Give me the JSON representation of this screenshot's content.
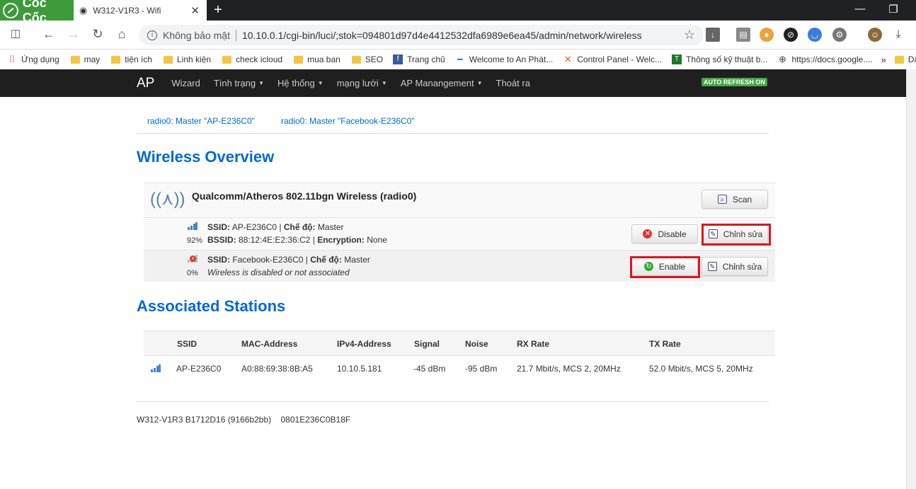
{
  "browser": {
    "brand": "Cốc Cốc",
    "tab_title": "W312-V1R3 - Wifi",
    "security": "Không bảo mật",
    "url": "10.10.0.1/cgi-bin/luci/;stok=094801d97d4e4412532dfa6989e6ea45/admin/network/wireless",
    "bookmarks": [
      "Ứng dụng",
      "may",
      "tiện ích",
      "Linh kiện",
      "check icloud",
      "mua ban",
      "SEO",
      "Trang chủ",
      "Welcome to An Phát...",
      "Control Panel - Welc...",
      "Thông số kỹ thuật b...",
      "https://docs.google....",
      "Dấu trang khác"
    ]
  },
  "nav": {
    "brand": "AP",
    "items": [
      "Wizard",
      "Tình trạng",
      "Hệ thống",
      "mạng lưới",
      "AP Manangement",
      "Thoát ra"
    ],
    "autorefresh": "AUTO REFRESH ON"
  },
  "subtabs": [
    "radio0: Master \"AP-E236C0\"",
    "radio0: Master \"Facebook-E236C0\""
  ],
  "wireless": {
    "title": "Wireless Overview",
    "device": "Qualcomm/Atheros 802.11bgn Wireless (radio0)",
    "scan_label": "Scan",
    "networks": [
      {
        "signal": "92%",
        "line1_k1": "SSID:",
        "line1_v1": "AP-E236C0 | ",
        "line1_k2": "Chế độ:",
        "line1_v2": "Master",
        "line2_k1": "BSSID:",
        "line2_v1": "88:12:4E:E2:36:C2 | ",
        "line2_k2": "Encryption:",
        "line2_v2": "None",
        "toggle_label": "Disable",
        "edit_label": "Chỉnh sửa"
      },
      {
        "signal": "0%",
        "line1_k1": "SSID:",
        "line1_v1": "Facebook-E236C0 | ",
        "line1_k2": "Chế độ:",
        "line1_v2": "Master",
        "line2": "Wireless is disabled or not associated",
        "toggle_label": "Enable",
        "edit_label": "Chỉnh sửa"
      }
    ]
  },
  "stations": {
    "title": "Associated Stations",
    "columns": [
      "SSID",
      "MAC-Address",
      "IPv4-Address",
      "Signal",
      "Noise",
      "RX Rate",
      "TX Rate"
    ],
    "rows": [
      [
        "AP-E236C0",
        "A0:88:69:38:8B:A5",
        "10.10.5.181",
        "-45 dBm",
        "-95 dBm",
        "21.7 Mbit/s, MCS 2, 20MHz",
        "52.0 Mbit/s, MCS 5, 20MHz"
      ]
    ]
  },
  "footer": {
    "version": "W312-V1R3 B1712D16 (9166b2bb)",
    "serial": "0801E236C0B18F"
  },
  "colors": {
    "link": "#0069d6",
    "highlight": "#e0141e",
    "nav_bg": "#1f1f1f",
    "autorefresh": "#46a546"
  }
}
